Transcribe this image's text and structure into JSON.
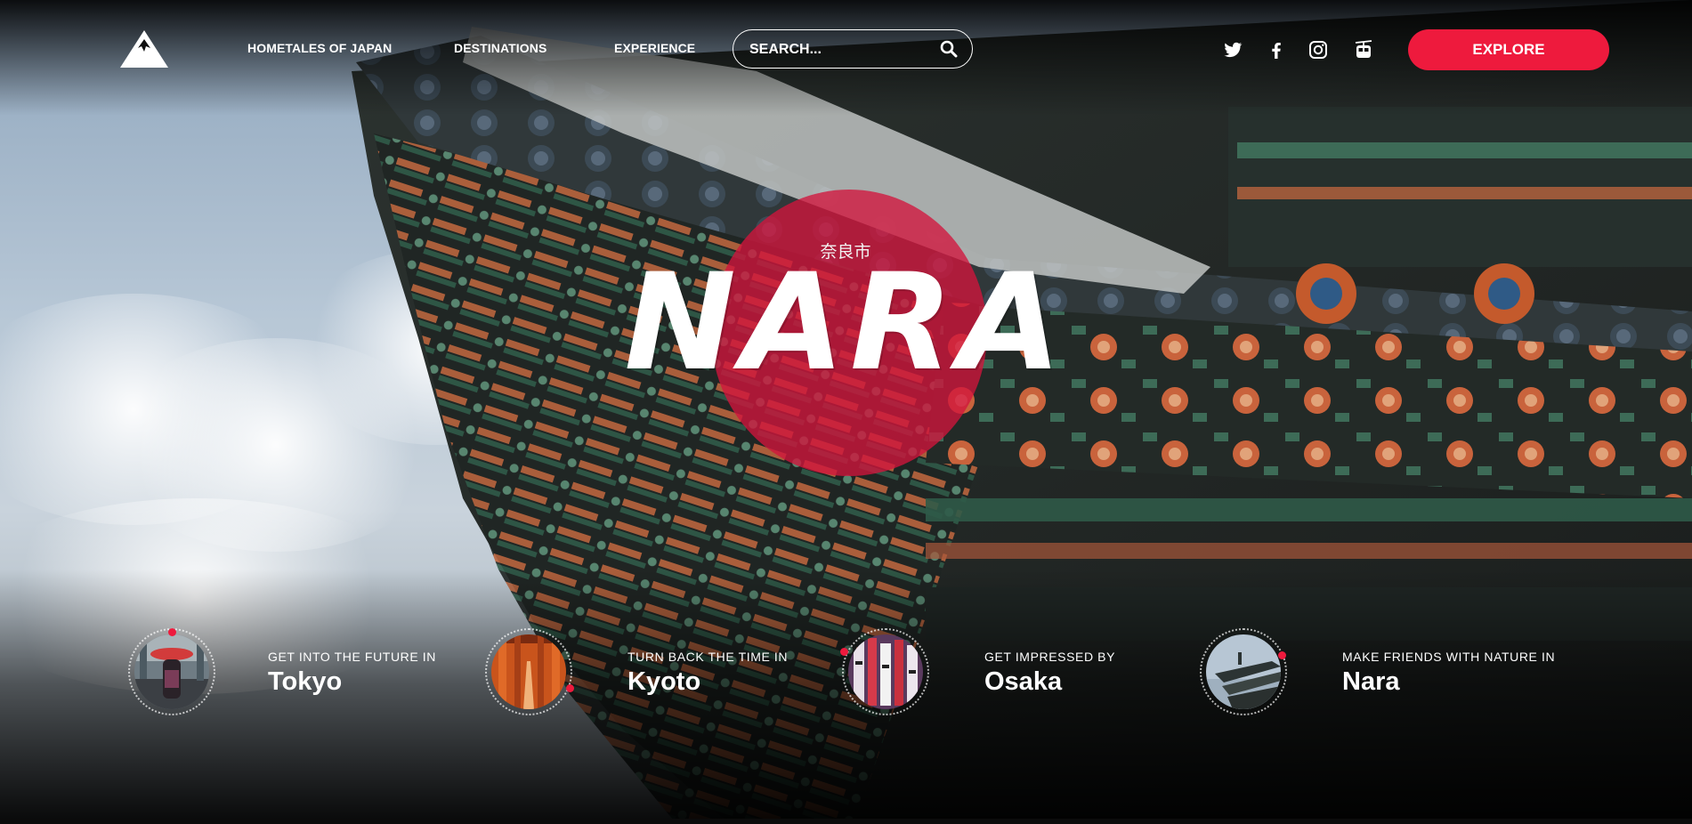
{
  "nav": {
    "items": [
      {
        "label": "HOMETALES OF JAPAN"
      },
      {
        "label": "DESTINATIONS"
      },
      {
        "label": "EXPERIENCE"
      }
    ]
  },
  "search": {
    "placeholder": "SEARCH..."
  },
  "social": [
    "twitter-icon",
    "facebook-icon",
    "instagram-icon",
    "cable-car-icon"
  ],
  "cta": {
    "label": "EXPLORE"
  },
  "hero": {
    "kanji": "奈良市",
    "title": "NARA"
  },
  "destinations": [
    {
      "kicker": "GET INTO THE FUTURE IN",
      "name": "Tokyo"
    },
    {
      "kicker": "TURN BACK THE TIME IN",
      "name": "Kyoto"
    },
    {
      "kicker": "GET IMPRESSED BY",
      "name": "Osaka"
    },
    {
      "kicker": "MAKE FRIENDS WITH NATURE IN",
      "name": "Nara"
    }
  ],
  "colors": {
    "accent": "#ee1a3d",
    "sun": "#d2143c",
    "text": "#ffffff"
  }
}
